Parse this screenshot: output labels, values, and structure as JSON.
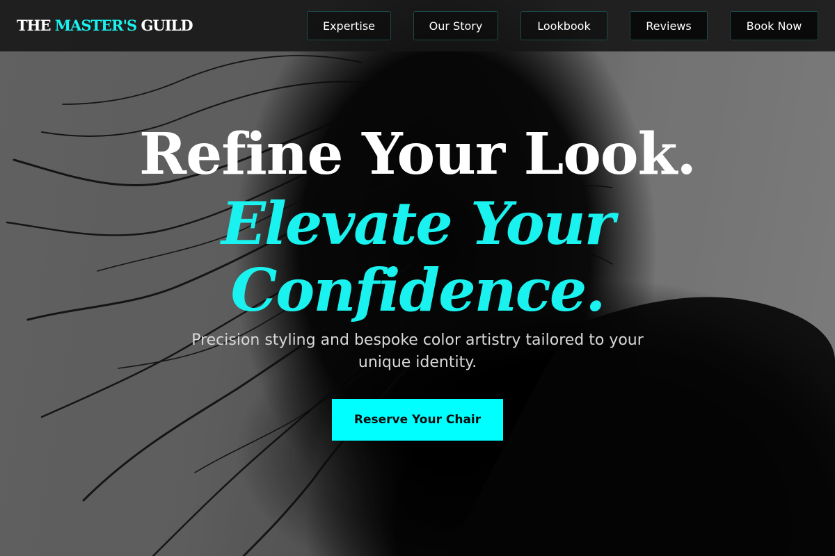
{
  "brand": {
    "part1": "THE ",
    "part2": "MASTER'S",
    "part3": " GUILD"
  },
  "nav": {
    "items": [
      {
        "label": "Expertise"
      },
      {
        "label": "Our Story"
      },
      {
        "label": "Lookbook"
      },
      {
        "label": "Reviews"
      },
      {
        "label": "Book Now"
      }
    ]
  },
  "hero": {
    "headline_line1": "Refine Your Look.",
    "headline_line2": "Elevate Your Confidence.",
    "subtitle": "Precision styling and bespoke color artistry tailored to your unique identity.",
    "cta_label": "Reserve Your Chair"
  },
  "colors": {
    "accent": "#19f2ef",
    "cta_background": "#00ffff",
    "nav_background": "#161616"
  }
}
